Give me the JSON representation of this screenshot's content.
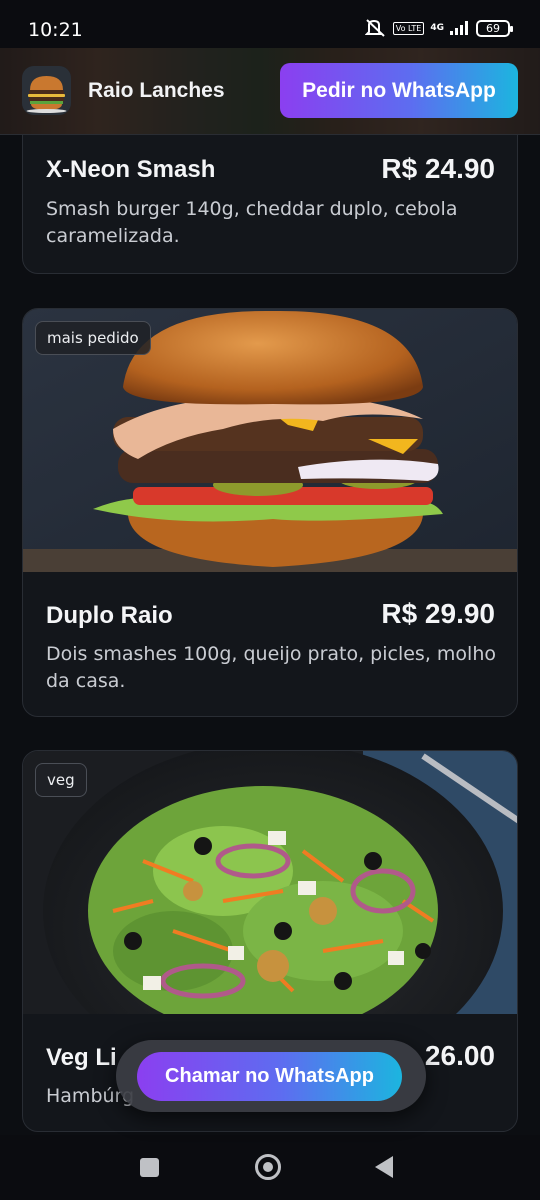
{
  "status_bar": {
    "time": "10:21",
    "network": "4G",
    "volte": "Vo LTE",
    "battery": "69",
    "icons": [
      "mute-icon",
      "volte-icon",
      "signal-icon",
      "battery-icon"
    ]
  },
  "header": {
    "brand": "Raio Lanches",
    "order_button": "Pedir no WhatsApp",
    "logo_icon": "burger-logo-icon"
  },
  "menu": {
    "items": [
      {
        "name": "X-Neon Smash",
        "price": "R$ 24.90",
        "description": "Smash burger 140g, cheddar duplo, cebola caramelizada.",
        "tag": "",
        "image": "burger-photo"
      },
      {
        "name": "Duplo Raio",
        "price": "R$ 29.90",
        "description": "Dois smashes 100g, queijo prato, picles, molho da casa.",
        "tag": "mais pedido",
        "image": "double-burger-photo"
      },
      {
        "name": "Veg Li",
        "price": "26.00",
        "description": "Hambúrg",
        "tag": "veg",
        "image": "salad-photo"
      }
    ]
  },
  "floating_button": {
    "label": "Chamar no WhatsApp"
  },
  "colors": {
    "accent_start": "#8b3ff0",
    "accent_end": "#1cb5df",
    "background": "#0c0e12",
    "card": "#13161b"
  }
}
